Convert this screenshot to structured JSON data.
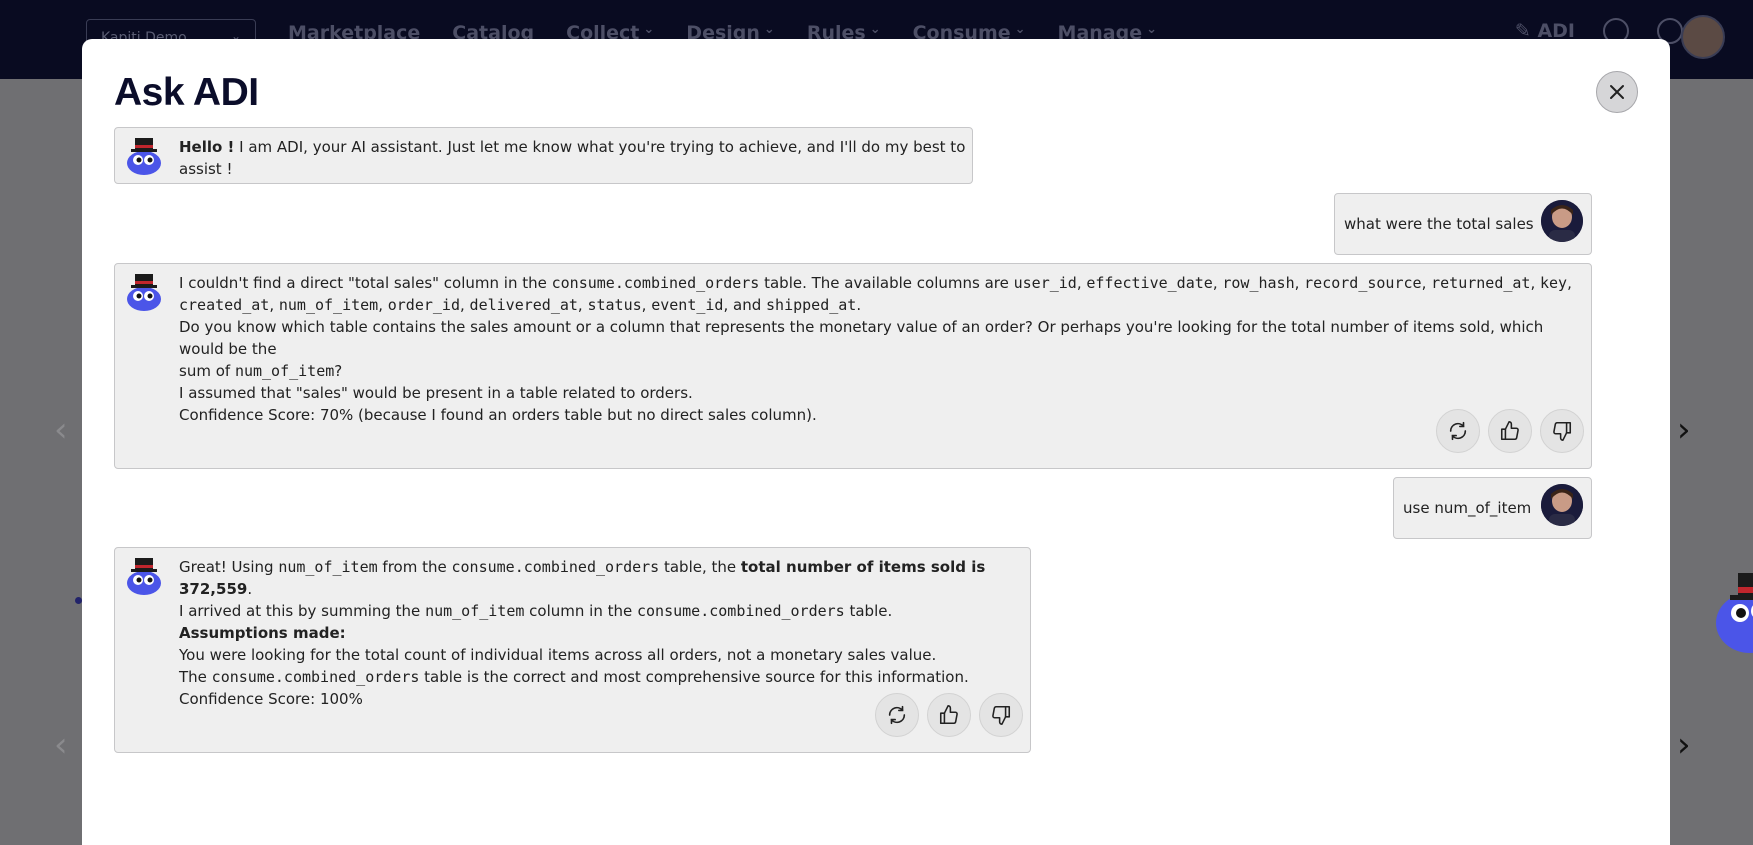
{
  "background": {
    "tenant": "Kapiti Demo",
    "nav_items": [
      "Marketplace",
      "Catalog",
      "Collect",
      "Design",
      "Rules",
      "Consume",
      "Manage"
    ],
    "nav_dropdowns": [
      false,
      false,
      true,
      true,
      true,
      true,
      true
    ],
    "adi_label": "ADI"
  },
  "modal": {
    "title": "Ask ADI"
  },
  "conversation": {
    "greeting": {
      "bold": "Hello !",
      "text": " I am ADI, your AI assistant. Just let me know what you're trying to achieve, and I'll do my best to assist !"
    },
    "user_1": "what were the total sales",
    "bot_1": {
      "p1_a": "I couldn't find a direct \"total sales\" column in the ",
      "p1_code": "consume.combined_orders",
      "p1_b": " table. The available columns are ",
      "columns": [
        "user_id",
        "effective_date",
        "row_hash",
        "record_source",
        "returned_at",
        "key",
        "created_at",
        "num_of_item",
        "order_id",
        "delivered_at",
        "status",
        "event_id",
        "shipped_at"
      ],
      "and_word": "and",
      "p2_a": "Do you know which table contains the sales amount or a column that represents the monetary value of an order? Or perhaps you're looking for the total number of items sold, which would be the",
      "p2_b": "sum of ",
      "p2_code": "num_of_item",
      "p2_c": "?",
      "p3": "I assumed that \"sales\" would be present in a table related to orders.",
      "p4": "Confidence Score: 70% (because I found an orders table but no direct sales column)."
    },
    "user_2": "use num_of_item",
    "bot_2": {
      "l1_a": "Great! Using ",
      "l1_code1": "num_of_item",
      "l1_b": " from the ",
      "l1_code2": "consume.combined_orders",
      "l1_c": " table, the ",
      "l1_bold": "total number of items sold is 372,559",
      "l1_d": ".",
      "l2_a": "I arrived at this by summing the ",
      "l2_code1": "num_of_item",
      "l2_b": " column in the ",
      "l2_code2": "consume.combined_orders",
      "l2_c": " table.",
      "l3_bold": "Assumptions made:",
      "l4": "You were looking for the total count of individual items across all orders, not a monetary sales value.",
      "l5_a": "The ",
      "l5_code": "consume.combined_orders",
      "l5_b": " table is the correct and most comprehensive source for this information.",
      "l6": "Confidence Score: 100%"
    },
    "action_icons": [
      "refresh-icon",
      "thumbs-up-icon",
      "thumbs-down-icon"
    ]
  }
}
